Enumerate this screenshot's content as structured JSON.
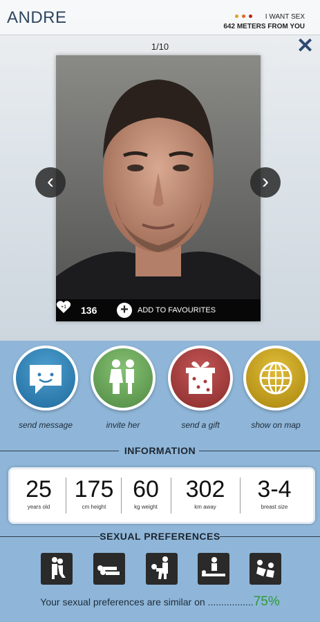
{
  "header": {
    "name": "ANDRE",
    "status": "I WANT SEX",
    "status_dots": [
      "#e0a020",
      "#e06a20",
      "#c02020"
    ],
    "distance": "642 METERS FROM YOU"
  },
  "gallery": {
    "counter": "1/10",
    "likes_icon_text": "+1",
    "likes": "136",
    "favourite_label": "ADD TO FAVOURITES"
  },
  "actions": [
    {
      "label": "send message",
      "icon": "chat-bubble-icon",
      "color": "#2e7fb2"
    },
    {
      "label": "invite her",
      "icon": "couple-icon",
      "color": "#6aa85a"
    },
    {
      "label": "send a gift",
      "icon": "gift-icon",
      "color": "#a83c3c"
    },
    {
      "label": "show on map",
      "icon": "globe-icon",
      "color": "#c7a21f"
    }
  ],
  "information": {
    "title": "INFORMATION",
    "stats": [
      {
        "value": "25",
        "unit": "years old"
      },
      {
        "value": "175",
        "unit": "cm height"
      },
      {
        "value": "60",
        "unit": "kg weight"
      },
      {
        "value": "302",
        "unit": "km away"
      },
      {
        "value": "3-4",
        "unit": "breast size"
      }
    ]
  },
  "preferences": {
    "title": "SEXUAL PREFERENCES",
    "icons": [
      "preference-1-icon",
      "preference-2-icon",
      "preference-3-icon",
      "preference-4-icon",
      "preference-5-icon"
    ],
    "similar_text": "Your sexual preferences are  similar on .................",
    "similar_percent": "75%"
  }
}
